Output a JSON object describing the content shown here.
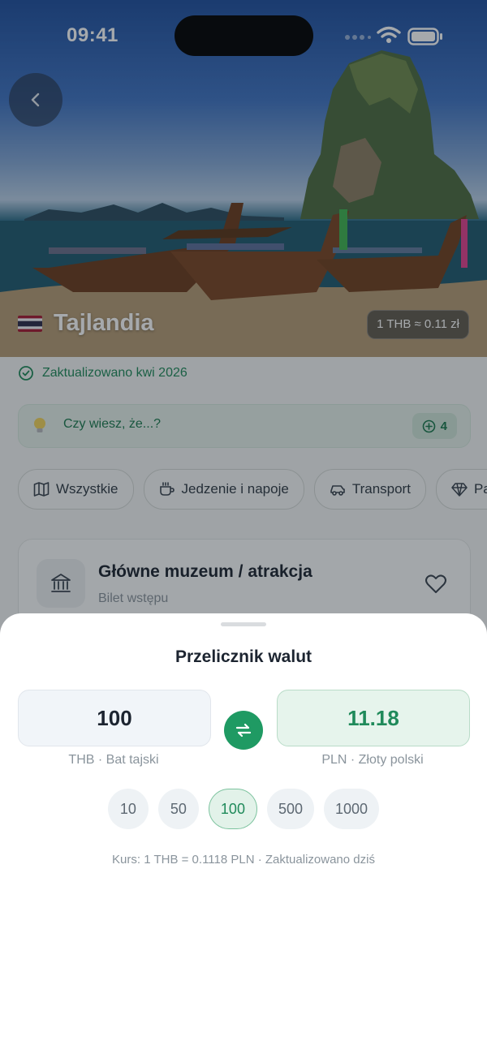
{
  "status_bar": {
    "time": "09:41"
  },
  "hero": {
    "country": "Tajlandia",
    "flag": "thailand-flag",
    "rate_badge": "1 THB ≈ 0.11 zł"
  },
  "updated": {
    "text": "Zaktualizowano kwi 2026",
    "icon": "check-circle-icon"
  },
  "tip": {
    "text": "Czy wiesz, że...?",
    "count": "4",
    "icon": "lightbulb-icon"
  },
  "categories": [
    {
      "label": "Wszystkie",
      "icon": "map-icon"
    },
    {
      "label": "Jedzenie i napoje",
      "icon": "coffee-cup-icon"
    },
    {
      "label": "Transport",
      "icon": "car-icon"
    },
    {
      "label": "Pa",
      "icon": "diamond-icon"
    }
  ],
  "card": {
    "title": "Główne muzeum / atrakcja",
    "subtitle": "Bilet wstępu",
    "icon": "museum-icon"
  },
  "converter": {
    "title": "Przelicznik walut",
    "from_value": "100",
    "from_label": "THB · Bat tajski",
    "to_value": "11.18",
    "to_label": "PLN · Złoty polski",
    "quick_amounts": [
      "10",
      "50",
      "100",
      "500",
      "1000"
    ],
    "selected_amount": "100",
    "rate_text": "Kurs: 1 THB = 0.1118 PLN · Zaktualizowano dziś"
  },
  "colors": {
    "accent": "#1f9a63",
    "accent_text": "#1f8a5a"
  }
}
